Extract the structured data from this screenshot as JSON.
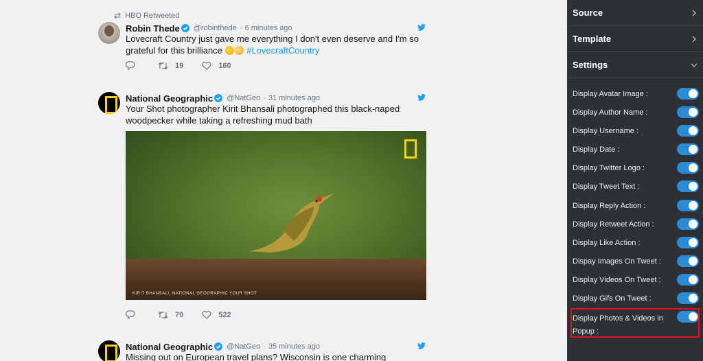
{
  "feed": {
    "retweet_note": "HBO Retweeted",
    "tweets": [
      {
        "name": "Robin Thede",
        "handle": "@robinthede",
        "time": "6 minutes ago",
        "text": "Lovecraft Country just gave me everything I don't even deserve and I'm so grateful for this brilliance",
        "hashtag": "#LovecraftCountry",
        "retweets": "19",
        "likes": "160"
      },
      {
        "name": "National Geographic",
        "handle": "@NatGeo",
        "time": "31 minutes ago",
        "text": "Your Shot photographer Kirit Bhansali photographed this black-naped woodpecker while taking a refreshing mud bath",
        "media_caption": "KIRIT BHANSALI, NATIONAL GEOGRAPHIC YOUR SHOT",
        "retweets": "70",
        "likes": "522"
      },
      {
        "name": "National Geographic",
        "handle": "@NatGeo",
        "time": "35 minutes ago",
        "text": "Missing out on European travel plans? Wisconsin is one charming alternative"
      }
    ]
  },
  "panel": {
    "sections": [
      "Source",
      "Template",
      "Settings"
    ],
    "settings": [
      "Display Avatar Image :",
      "Display Author Name :",
      "Display Username :",
      "Display Date :",
      "Display Twitter Logo :",
      "Display Tweet Text :",
      "Display Reply Action :",
      "Display Retweet Action :",
      "Display Like Action :",
      "Dispay Images On Tweet :",
      "Display Videos On Tweet :",
      "Display Gifs On Tweet :"
    ],
    "last_setting": "Display Photos & Videos in Popup :",
    "toggle_states": [
      "on",
      "on",
      "on",
      "on",
      "on",
      "on",
      "on",
      "on",
      "on",
      "on",
      "on",
      "on",
      "on"
    ],
    "accent": "#2a8bd6",
    "highlight_color": "#e0141c"
  },
  "icons": {
    "retweet": "retweet-icon",
    "reply": "reply-icon",
    "like": "heart-icon",
    "verified": "verified-badge-icon",
    "twitter": "twitter-bird-icon",
    "chevron_right": "chevron-right-icon",
    "chevron_down": "chevron-down-icon"
  }
}
